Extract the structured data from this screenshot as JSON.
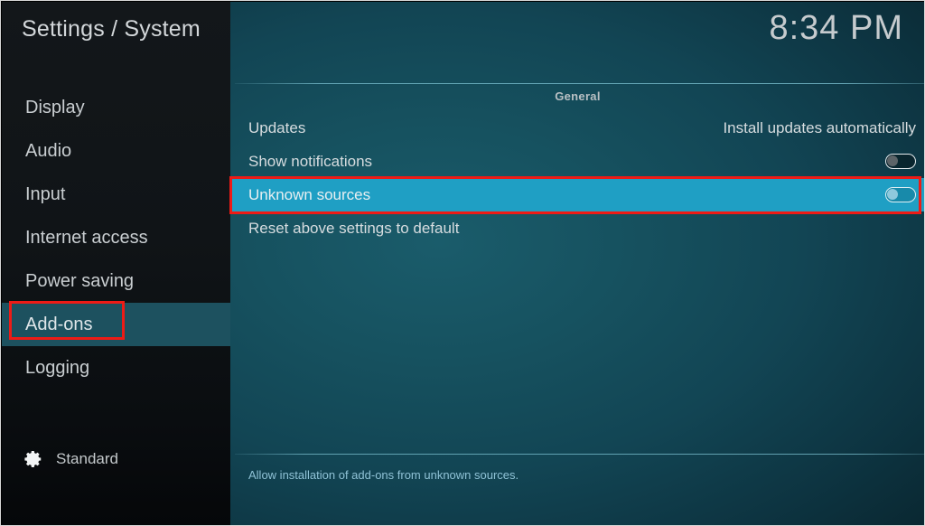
{
  "window": {
    "title": "Settings / System",
    "clock": "8:34 PM"
  },
  "theme": {
    "accent_highlight": "#1f9fc4",
    "sidebar_selected": "#1d515f",
    "annotation": "#ee1b16",
    "help_text": "#8fc2d6",
    "body_text": "#d6dcdf"
  },
  "sidebar": {
    "items": [
      {
        "label": "Display",
        "selected": false
      },
      {
        "label": "Audio",
        "selected": false
      },
      {
        "label": "Input",
        "selected": false
      },
      {
        "label": "Internet access",
        "selected": false
      },
      {
        "label": "Power saving",
        "selected": false
      },
      {
        "label": "Add-ons",
        "selected": true
      },
      {
        "label": "Logging",
        "selected": false
      }
    ],
    "profile": {
      "icon": "gear-icon",
      "label": "Standard"
    }
  },
  "main": {
    "group_header": "General",
    "rows": [
      {
        "label": "Updates",
        "control": "value",
        "value": "Install updates automatically",
        "highlighted": false
      },
      {
        "label": "Show notifications",
        "control": "toggle",
        "toggle_state": "off",
        "highlighted": false
      },
      {
        "label": "Unknown sources",
        "control": "toggle",
        "toggle_state": "off",
        "highlighted": true
      },
      {
        "label": "Reset above settings to default",
        "control": "none",
        "highlighted": false
      }
    ],
    "help_text": "Allow installation of add-ons from unknown sources."
  },
  "annotations": [
    {
      "name": "annotation-box-addons",
      "target": "Add-ons"
    },
    {
      "name": "annotation-box-unknown",
      "target": "Unknown sources"
    }
  ]
}
